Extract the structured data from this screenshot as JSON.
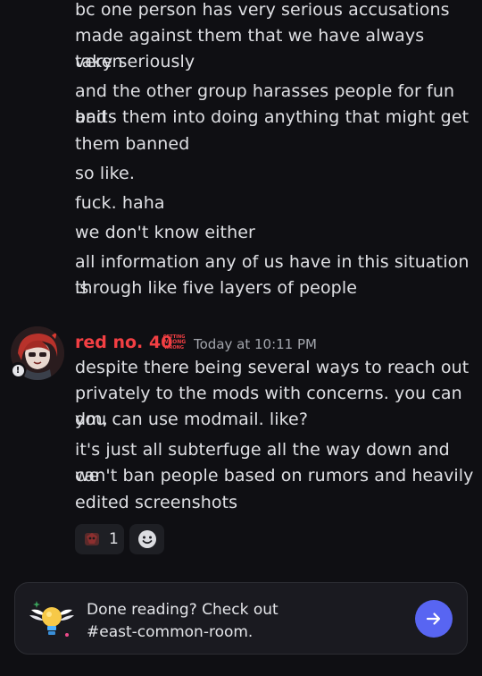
{
  "messages": {
    "previous": [
      "bc one person has very serious accusations",
      "made against them that we have always taken",
      "very seriously",
      "and the other group harasses people for fun and",
      "baits them into doing anything that might get",
      "them banned",
      "so like.",
      "fuck. haha",
      "we don't know either",
      "all information any of us have in this situation is",
      "through like five layers of people"
    ],
    "current": {
      "username": "red no. 40",
      "user_tag": [
        "GETTING",
        "WRONG",
        "WRONG"
      ],
      "timestamp": "Today at 10:11 PM",
      "lines": [
        "despite there being several ways to reach out",
        "privately to the mods with concerns. you can dm,",
        "you can use modmail. like?",
        "it's just all subterfuge all the way down and we",
        "can't ban people based on rumors and heavily",
        "edited screenshots"
      ],
      "reactions": [
        {
          "emoji": "custom-emoji",
          "count": "1"
        },
        {
          "emoji": "add-reaction-icon",
          "count": ""
        }
      ]
    }
  },
  "banner": {
    "line1": "Done reading? Check out",
    "line2": "#east-common-room.",
    "icon": "lightbulb-wings-icon",
    "accent": "#5865f2"
  },
  "colors": {
    "username": "#f23f43",
    "background": "#0f0f13"
  }
}
